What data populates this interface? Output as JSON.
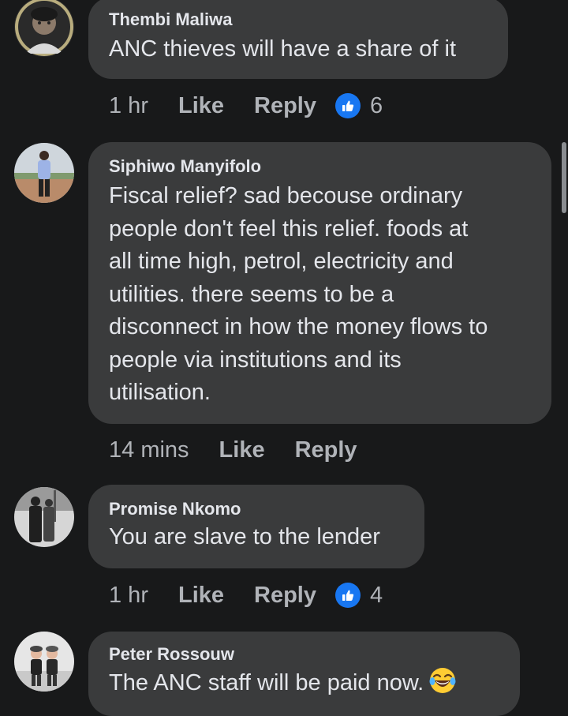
{
  "comments": [
    {
      "author": "Thembi Maliwa",
      "text": "ANC thieves will have a share of it",
      "time": "1 hr",
      "like_label": "Like",
      "reply_label": "Reply",
      "reaction_count": "6",
      "avatar_icon": "avatar-woman-portrait"
    },
    {
      "author": "Siphiwo Manyifolo",
      "text_lines": [
        "Fiscal relief? sad becouse ordinary",
        "people don't feel this relief. foods at",
        "all time high, petrol, electricity and",
        "utilities. there seems to be a",
        "disconnect in how the money flows to",
        "people via institutions and its",
        "utilisation."
      ],
      "time": "14 mins",
      "like_label": "Like",
      "reply_label": "Reply",
      "avatar_icon": "avatar-man-standing"
    },
    {
      "author": "Promise Nkomo",
      "text": "You are slave to the lender",
      "time": "1 hr",
      "like_label": "Like",
      "reply_label": "Reply",
      "reaction_count": "4",
      "avatar_icon": "avatar-two-people-bw"
    },
    {
      "author": "Peter Rossouw",
      "text": "The ANC staff will be paid now.",
      "emoji": "laughing-tears-emoji",
      "avatar_icon": "avatar-two-children"
    }
  ],
  "colors": {
    "background": "#18191a",
    "bubble": "#3a3b3c",
    "text": "#e4e6eb",
    "secondary_text": "#b0b3b8",
    "like_blue": "#1877f2"
  }
}
